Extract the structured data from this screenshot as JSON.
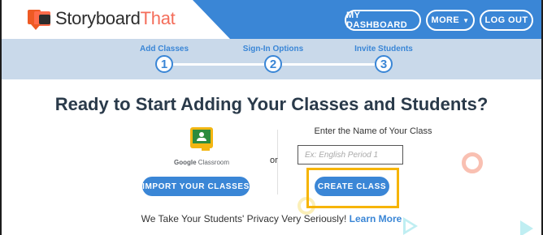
{
  "header": {
    "logo_text_main": "Storyboard",
    "logo_text_accent": "That",
    "buttons": {
      "dashboard": "MY DASHBOARD",
      "more": "MORE",
      "logout": "LOG OUT"
    }
  },
  "steps": [
    {
      "label": "Add Classes",
      "number": "1"
    },
    {
      "label": "Sign-In Options",
      "number": "2"
    },
    {
      "label": "Invite Students",
      "number": "3"
    }
  ],
  "main": {
    "headline": "Ready to Start Adding Your Classes and Students?",
    "google_classroom": {
      "label_brand": "Google",
      "label_product": "Classroom",
      "import_button": "IMPORT YOUR CLASSES"
    },
    "or_text": "or",
    "create": {
      "label": "Enter the Name of Your Class",
      "input_value": "",
      "input_placeholder": "Ex: English Period 1",
      "button": "CREATE CLASS"
    },
    "privacy": {
      "text": "We Take Your Students' Privacy Very Seriously!",
      "link": "Learn More"
    }
  },
  "colors": {
    "primary_blue": "#3a86d6",
    "steps_bg": "#c9d9ea",
    "highlight": "#f6b400",
    "logo_accent": "#f46d5a"
  }
}
